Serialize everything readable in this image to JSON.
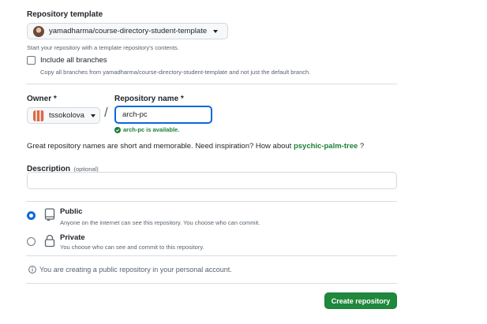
{
  "template": {
    "label": "Repository template",
    "selected": "yamadharma/course-directory-student-template",
    "note": "Start your repository with a template repository's contents."
  },
  "branches": {
    "label": "Include all branches",
    "note": "Copy all branches from yamadharma/course-directory-student-template and not just the default branch.",
    "checked": false
  },
  "owner": {
    "label": "Owner *",
    "selected": "tssokolova"
  },
  "separator": "/",
  "repo_name": {
    "label": "Repository name *",
    "value": "arch-pc",
    "availability": "arch-pc is available."
  },
  "suggestion": {
    "text": "Great repository names are short and memorable. Need inspiration? How about",
    "name": "psychic-palm-tree",
    "suffix": "?"
  },
  "description": {
    "label": "Description",
    "optional": "(optional)",
    "value": ""
  },
  "visibility": {
    "selected": "public",
    "public_title": "Public",
    "public_note": "Anyone on the internet can see this repository. You choose who can commit.",
    "private_title": "Private",
    "private_note": "You choose who can see and commit to this repository."
  },
  "info": "You are creating a public repository in your personal account.",
  "create_label": "Create repository",
  "colors": {
    "accent": "#0969da",
    "success": "#1a7f37",
    "button": "#1f883d"
  }
}
